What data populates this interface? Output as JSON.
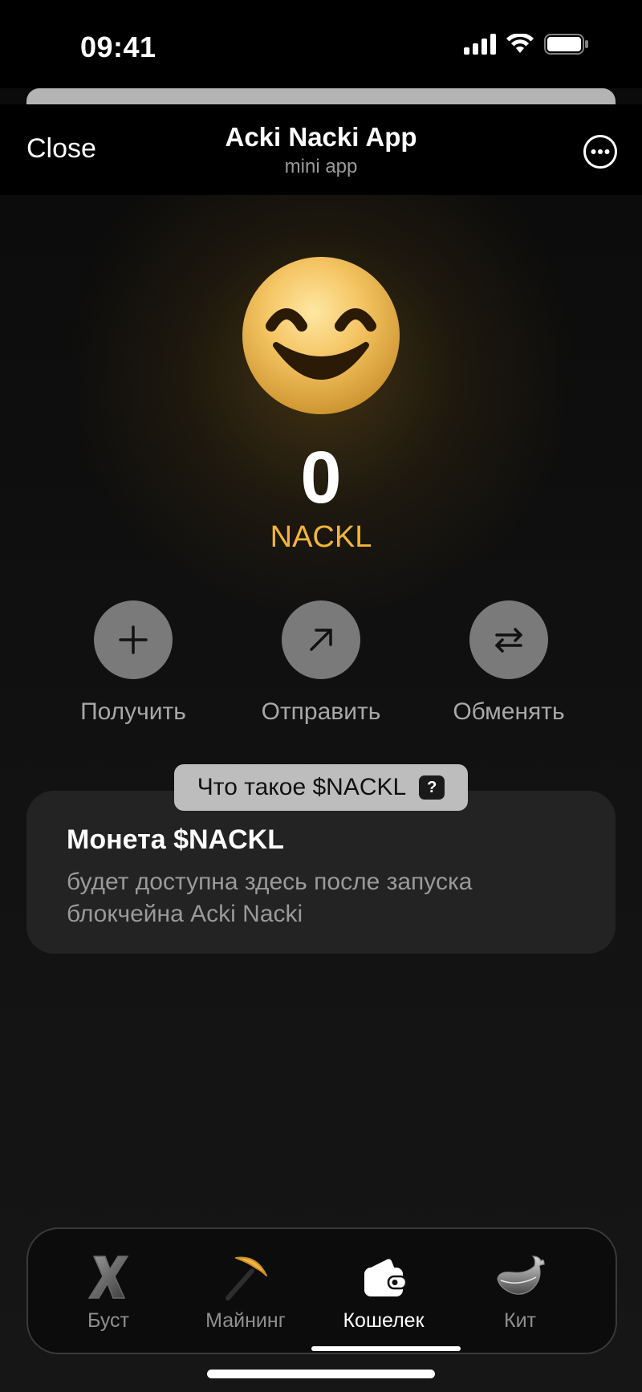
{
  "status_bar": {
    "time": "09:41"
  },
  "header": {
    "close_label": "Close",
    "title": "Acki Nacki App",
    "subtitle": "mini app"
  },
  "wallet": {
    "balance": "0",
    "currency": "NACKL",
    "accent_color": "#f2b53c"
  },
  "actions": [
    {
      "label": "Получить",
      "icon": "plus-icon"
    },
    {
      "label": "Отправить",
      "icon": "arrow-up-right-icon"
    },
    {
      "label": "Обменять",
      "icon": "swap-arrows-icon"
    }
  ],
  "info": {
    "pill_label": "Что такое $NACKL",
    "pill_badge": "?",
    "title": "Монета $NACKL",
    "body": "будет доступна здесь после запуска блокчейна Acki Nacki"
  },
  "nav": {
    "items": [
      {
        "label": "Буст",
        "icon": "x-icon",
        "active": false
      },
      {
        "label": "Майнинг",
        "icon": "pickaxe-icon",
        "active": false
      },
      {
        "label": "Кошелек",
        "icon": "wallet-icon",
        "active": true
      },
      {
        "label": "Кит",
        "icon": "whale-icon",
        "active": false
      }
    ]
  }
}
